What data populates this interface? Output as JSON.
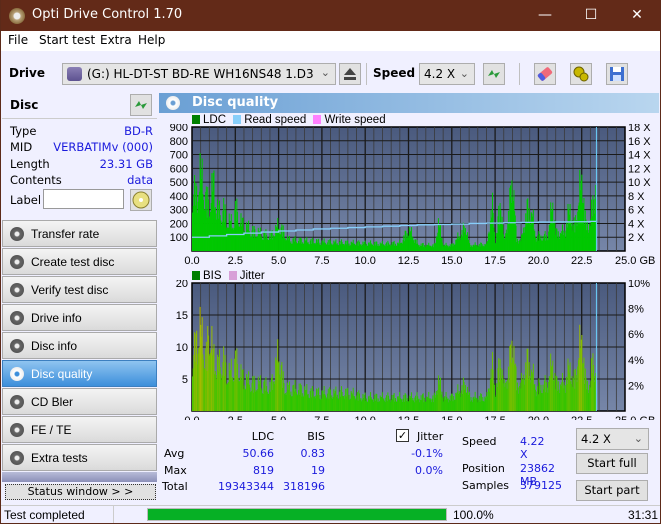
{
  "window": {
    "title": "Opti Drive Control 1.70",
    "controls": {
      "minimize": "—",
      "maximize": "☐",
      "close": "✕"
    }
  },
  "menu": [
    "File",
    "Start test",
    "Extra",
    "Help"
  ],
  "toolbar": {
    "drive_label": "Drive",
    "drive_value": "(G:)  HL-DT-ST BD-RE  WH16NS48 1.D3",
    "speed_label": "Speed",
    "speed_value": "4.2 X",
    "icons": [
      "eject-icon",
      "refresh-icon",
      "erase-icon",
      "settings-icon",
      "save-icon"
    ]
  },
  "disc": {
    "header": "Disc",
    "fields": [
      {
        "key": "Type",
        "value": "BD-R"
      },
      {
        "key": "MID",
        "value": "VERBATIMv (000)"
      },
      {
        "key": "Length",
        "value": "23.31 GB"
      },
      {
        "key": "Contents",
        "value": "data"
      }
    ],
    "label_key": "Label",
    "label_value": ""
  },
  "nav": [
    {
      "label": "Transfer rate",
      "active": false
    },
    {
      "label": "Create test disc",
      "active": false
    },
    {
      "label": "Verify test disc",
      "active": false
    },
    {
      "label": "Drive info",
      "active": false
    },
    {
      "label": "Disc info",
      "active": false
    },
    {
      "label": "Disc quality",
      "active": true
    },
    {
      "label": "CD Bler",
      "active": false
    },
    {
      "label": "FE / TE",
      "active": false
    },
    {
      "label": "Extra tests",
      "active": false
    }
  ],
  "status_window_label": "Status window > >",
  "panel_title": "Disc quality",
  "chart_data": [
    {
      "type": "area",
      "title": "LDC",
      "legend": [
        {
          "name": "LDC",
          "color": "#008000"
        },
        {
          "name": "Read speed",
          "color": "#87cefa"
        },
        {
          "name": "Write speed",
          "color": "#ff80ff"
        }
      ],
      "legend_placement": "top-left",
      "x_ticks": [
        "0.0",
        "2.5",
        "5.0",
        "7.5",
        "10.0",
        "12.5",
        "15.0",
        "17.5",
        "20.0",
        "22.5",
        "25.0 GB"
      ],
      "xlim": [
        0,
        25
      ],
      "y_ticks": [
        "100",
        "200",
        "300",
        "400",
        "500",
        "600",
        "700",
        "800",
        "900"
      ],
      "ylim": [
        0,
        900
      ],
      "y2_ticks": [
        "2 X",
        "4 X",
        "6 X",
        "8 X",
        "10 X",
        "12 X",
        "14 X",
        "16 X",
        "18 X"
      ],
      "y2lim": [
        0,
        18
      ],
      "grid": true,
      "ldc_envelope": [
        [
          0,
          620
        ],
        [
          0.25,
          560
        ],
        [
          0.4,
          819
        ],
        [
          0.6,
          700
        ],
        [
          0.8,
          520
        ],
        [
          1.0,
          480
        ],
        [
          1.2,
          700
        ],
        [
          1.5,
          380
        ],
        [
          1.8,
          420
        ],
        [
          2.0,
          320
        ],
        [
          2.3,
          280
        ],
        [
          2.5,
          430
        ],
        [
          2.8,
          300
        ],
        [
          3.0,
          260
        ],
        [
          3.5,
          200
        ],
        [
          4.0,
          180
        ],
        [
          4.5,
          150
        ],
        [
          5.0,
          270
        ],
        [
          5.5,
          120
        ],
        [
          6.0,
          110
        ],
        [
          7.0,
          100
        ],
        [
          8.0,
          90
        ],
        [
          9.0,
          85
        ],
        [
          10.0,
          80
        ],
        [
          11.0,
          75
        ],
        [
          12.0,
          80
        ],
        [
          12.5,
          220
        ],
        [
          13.0,
          70
        ],
        [
          13.5,
          60
        ],
        [
          14.0,
          60
        ],
        [
          14.2,
          300
        ],
        [
          14.5,
          60
        ],
        [
          15.0,
          60
        ],
        [
          15.8,
          250
        ],
        [
          16.0,
          60
        ],
        [
          17.0,
          70
        ],
        [
          17.3,
          470
        ],
        [
          17.5,
          80
        ],
        [
          17.8,
          530
        ],
        [
          18.0,
          90
        ],
        [
          18.3,
          450
        ],
        [
          18.5,
          800
        ],
        [
          18.7,
          120
        ],
        [
          19.0,
          120
        ],
        [
          19.3,
          420
        ],
        [
          19.6,
          400
        ],
        [
          19.8,
          150
        ],
        [
          20.5,
          150
        ],
        [
          20.8,
          490
        ],
        [
          21.0,
          180
        ],
        [
          21.5,
          200
        ],
        [
          21.8,
          450
        ],
        [
          22.0,
          220
        ],
        [
          22.3,
          500
        ],
        [
          22.5,
          800
        ],
        [
          22.7,
          260
        ],
        [
          23.0,
          300
        ],
        [
          23.1,
          500
        ],
        [
          23.3,
          700
        ],
        [
          23.35,
          0
        ]
      ],
      "read_speed": [
        [
          0,
          2.0
        ],
        [
          1.0,
          2.2
        ],
        [
          2.0,
          2.4
        ],
        [
          3.0,
          2.6
        ],
        [
          4.0,
          2.75
        ],
        [
          5.0,
          2.9
        ],
        [
          6.0,
          3.05
        ],
        [
          7.0,
          3.2
        ],
        [
          8.0,
          3.3
        ],
        [
          9.0,
          3.4
        ],
        [
          10.0,
          3.5
        ],
        [
          11.0,
          3.6
        ],
        [
          12.0,
          3.7
        ],
        [
          13.0,
          3.8
        ],
        [
          14.0,
          3.85
        ],
        [
          15.0,
          3.9
        ],
        [
          16.0,
          4.0
        ],
        [
          17.0,
          4.05
        ],
        [
          18.0,
          4.1
        ],
        [
          19.0,
          4.15
        ],
        [
          20.0,
          4.2
        ],
        [
          21.0,
          4.22
        ],
        [
          22.0,
          4.25
        ],
        [
          23.0,
          4.3
        ],
        [
          23.3,
          4.4
        ]
      ]
    },
    {
      "type": "bar",
      "title": "BIS",
      "legend": [
        {
          "name": "BIS",
          "color": "#008000"
        },
        {
          "name": "Jitter",
          "color": "#d8a0d8"
        }
      ],
      "legend_placement": "top-left",
      "x_ticks": [
        "0.0",
        "2.5",
        "5.0",
        "7.5",
        "10.0",
        "12.5",
        "15.0",
        "17.5",
        "20.0",
        "22.5",
        "25.0 GB"
      ],
      "xlim": [
        0,
        25
      ],
      "y_ticks": [
        "5",
        "10",
        "15",
        "20"
      ],
      "ylim": [
        0,
        20
      ],
      "y2_ticks": [
        "2%",
        "4%",
        "6%",
        "8%",
        "10%"
      ],
      "y2lim": [
        0,
        10
      ],
      "grid": true,
      "bis_envelope": [
        [
          0,
          12
        ],
        [
          0.2,
          14
        ],
        [
          0.4,
          19
        ],
        [
          0.6,
          15
        ],
        [
          0.8,
          12
        ],
        [
          1.0,
          18
        ],
        [
          1.2,
          12
        ],
        [
          1.5,
          10
        ],
        [
          1.8,
          11
        ],
        [
          2.0,
          8
        ],
        [
          2.3,
          9
        ],
        [
          2.5,
          11
        ],
        [
          2.8,
          8
        ],
        [
          3.0,
          7
        ],
        [
          3.5,
          6
        ],
        [
          4.0,
          6
        ],
        [
          4.5,
          5
        ],
        [
          5.0,
          13
        ],
        [
          5.3,
          5
        ],
        [
          6.0,
          5
        ],
        [
          7.0,
          4
        ],
        [
          8.0,
          4
        ],
        [
          9.0,
          4
        ],
        [
          10.0,
          3
        ],
        [
          11.0,
          3
        ],
        [
          12.0,
          3
        ],
        [
          13.0,
          3
        ],
        [
          14.0,
          3
        ],
        [
          14.2,
          7
        ],
        [
          14.5,
          3
        ],
        [
          15.0,
          3
        ],
        [
          15.8,
          6
        ],
        [
          16.0,
          3
        ],
        [
          17.0,
          3
        ],
        [
          17.3,
          10
        ],
        [
          17.5,
          4
        ],
        [
          17.8,
          12
        ],
        [
          18.0,
          5
        ],
        [
          18.3,
          10
        ],
        [
          18.5,
          17
        ],
        [
          18.7,
          6
        ],
        [
          19.0,
          6
        ],
        [
          19.3,
          11
        ],
        [
          19.6,
          9
        ],
        [
          19.8,
          5
        ],
        [
          20.5,
          6
        ],
        [
          20.8,
          11
        ],
        [
          21.0,
          6
        ],
        [
          21.5,
          6
        ],
        [
          21.8,
          10
        ],
        [
          22.0,
          6
        ],
        [
          22.3,
          12
        ],
        [
          22.5,
          17
        ],
        [
          22.7,
          6
        ],
        [
          23.0,
          6
        ],
        [
          23.1,
          12
        ],
        [
          23.3,
          8
        ],
        [
          23.35,
          0
        ]
      ]
    }
  ],
  "stats": {
    "col_ldc": "LDC",
    "col_bis": "BIS",
    "jitter_label": "Jitter",
    "jitter_checked": true,
    "rows": [
      {
        "label": "Avg",
        "ldc": "50.66",
        "bis": "0.83",
        "jitter": "-0.1%"
      },
      {
        "label": "Max",
        "ldc": "819",
        "bis": "19",
        "jitter": "0.0%"
      },
      {
        "label": "Total",
        "ldc": "19343344",
        "bis": "318196",
        "jitter": ""
      }
    ],
    "speed_label": "Speed",
    "speed_value": "4.22 X",
    "position_label": "Position",
    "position_value": "23862 MB",
    "samples_label": "Samples",
    "samples_value": "379125",
    "speed_select": "4.2 X",
    "start_full": "Start full",
    "start_part": "Start part"
  },
  "statusbar": {
    "text": "Test completed",
    "progress": 1.0,
    "progress_text": "100.0%",
    "time": "31:31"
  }
}
